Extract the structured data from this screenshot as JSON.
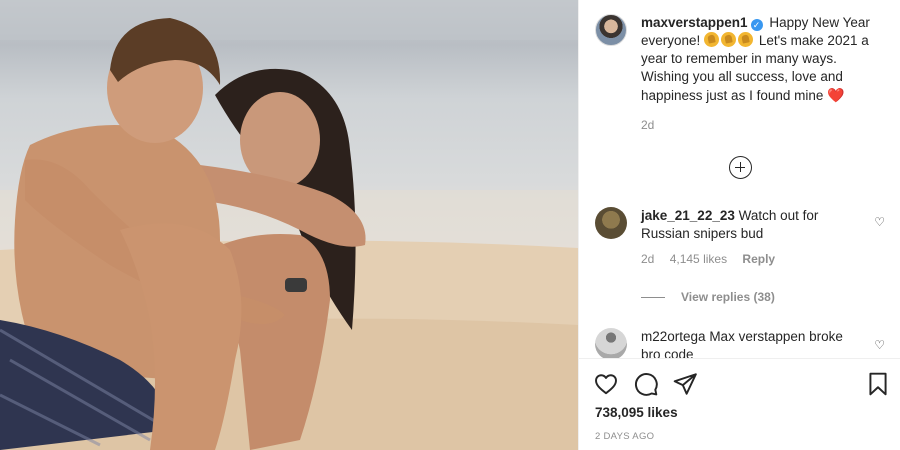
{
  "post": {
    "author": {
      "username": "maxverstappen1",
      "verified": true
    },
    "caption": {
      "text_before_emoji": "Happy New Year everyone!",
      "emojis": [
        "clapping-hands",
        "clapping-hands",
        "clapping-hands"
      ],
      "text_after_emoji": "Let's make 2021 a year to remember in many ways. Wishing you all success, love and happiness just as I found mine",
      "trailing_emoji": "❤️"
    },
    "caption_time": "2d",
    "likes": "738,095 likes",
    "posted_ago": "2 DAYS AGO"
  },
  "comments": [
    {
      "username": "jake_21_22_23",
      "text": "Watch out for Russian snipers bud",
      "time": "2d",
      "likes": "4,145 likes",
      "reply_label": "Reply",
      "view_replies": "View replies (38)"
    },
    {
      "username": "m22ortega",
      "text": "Max verstappen broke bro code"
    }
  ],
  "actions": {
    "like_icon": "heart-outline-icon",
    "comment_icon": "speech-bubble-icon",
    "share_icon": "paper-plane-icon",
    "save_icon": "bookmark-icon",
    "load_more_icon": "plus-circle-icon"
  },
  "colors": {
    "link_blue": "#3897f0",
    "muted_text": "#8e8e8e",
    "heart_red": "#e0245e"
  }
}
